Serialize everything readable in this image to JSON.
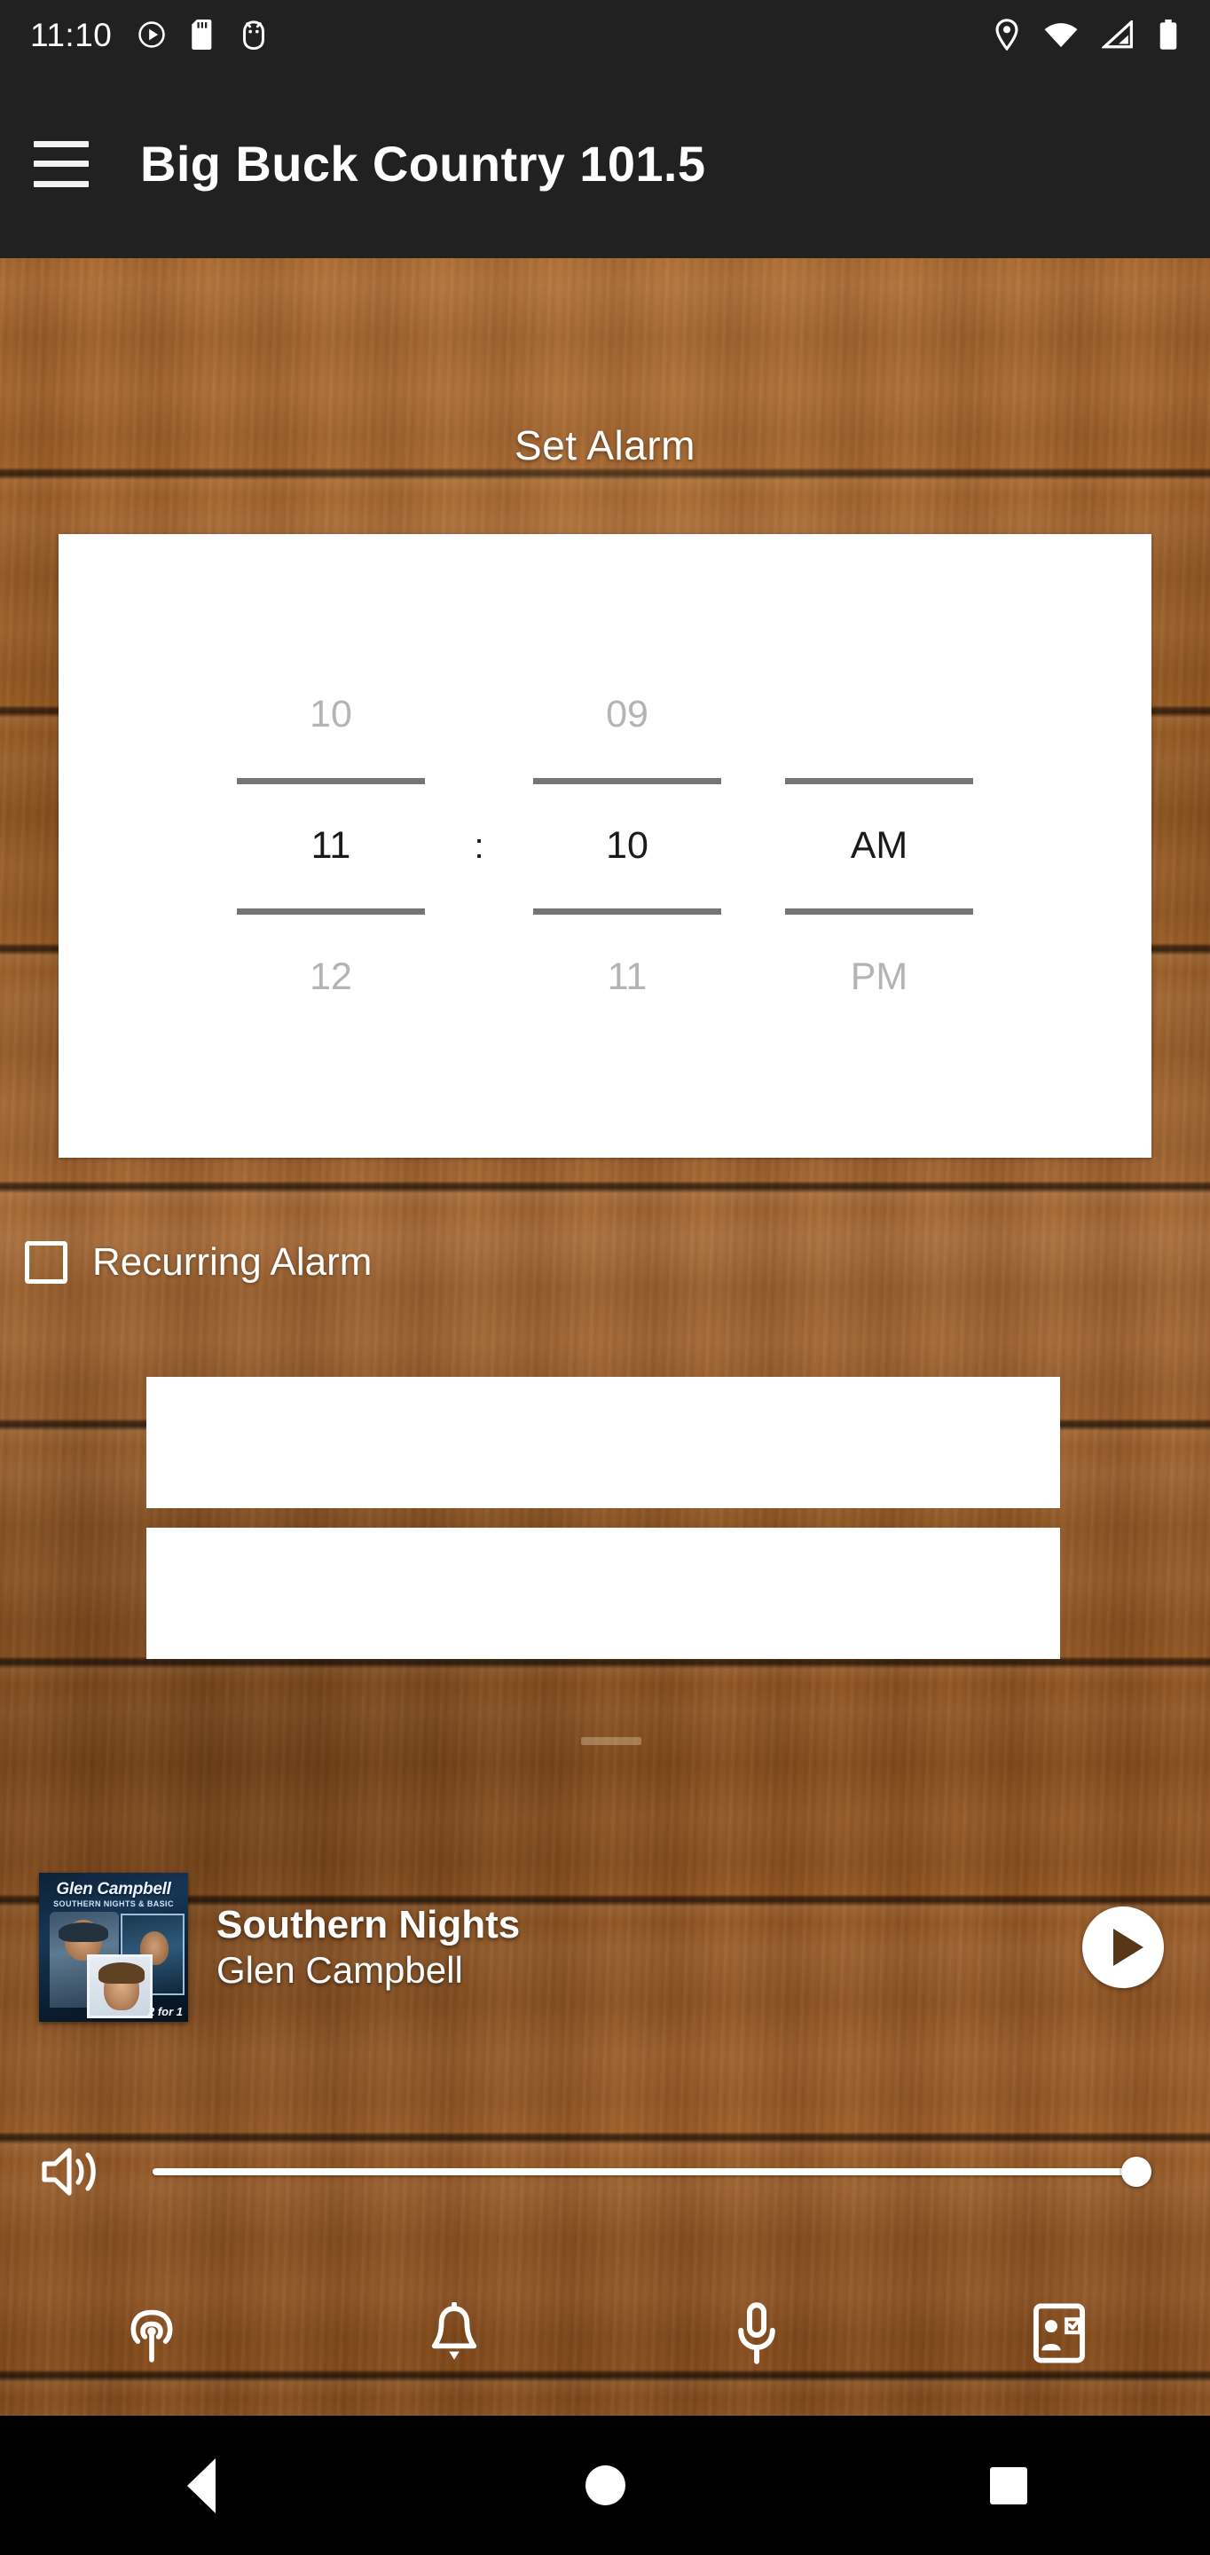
{
  "statusbar": {
    "clock": "11:10",
    "left_icons": [
      "play-circle-icon",
      "sd-card-icon",
      "android-debug-icon"
    ],
    "right_icons": [
      "location-pin-icon",
      "wifi-icon",
      "cell-signal-icon",
      "battery-icon"
    ],
    "background_color": "#212121"
  },
  "toolbar": {
    "menu_icon": "hamburger-menu-icon",
    "title": "Big Buck Country 101.5",
    "background_color": "#212121",
    "title_color": "#ffffff"
  },
  "screen": {
    "heading": "Set Alarm",
    "background": "wood-texture",
    "wood_color": "#9a5d2c"
  },
  "time_picker": {
    "hour": {
      "above": "10",
      "selected": "11",
      "below": "12"
    },
    "separator": ":",
    "minute": {
      "above": "09",
      "selected": "10",
      "below": "11"
    },
    "meridiem": {
      "above": "",
      "selected": "AM",
      "below": "PM"
    },
    "card_color": "#ffffff",
    "selected_text_color": "#1a1a1a",
    "dim_text_color": "#b4b4b4",
    "divider_color": "#757575"
  },
  "recurring": {
    "label": "Recurring Alarm",
    "checked": false,
    "checkbox_icon": "checkbox-unchecked-icon"
  },
  "panels": [
    {
      "name": "blank-panel-top",
      "text": ""
    },
    {
      "name": "blank-panel-bottom",
      "text": ""
    }
  ],
  "now_playing": {
    "album_art": {
      "artist_line": "Glen Campbell",
      "album_line": "SOUTHERN NIGHTS & BASIC",
      "badge": "2 for 1"
    },
    "song": "Southern Nights",
    "artist": "Glen Campbell",
    "play_button_icon": "play-icon",
    "play_button_label": "Play"
  },
  "volume": {
    "icon": "speaker-volume-icon",
    "value": 100,
    "min": 0,
    "max": 100,
    "track_color": "#ffffff"
  },
  "bottom_nav": [
    {
      "name": "nav-broadcast",
      "icon": "broadcast-antenna-icon",
      "label": "Listen"
    },
    {
      "name": "nav-alarm",
      "icon": "bell-icon",
      "label": "Alarm"
    },
    {
      "name": "nav-microphone",
      "icon": "microphone-icon",
      "label": "Request"
    },
    {
      "name": "nav-contact",
      "icon": "contact-card-icon",
      "label": "Contact"
    }
  ],
  "system_nav": {
    "back": "back-triangle-icon",
    "home": "home-circle-icon",
    "recents": "recents-square-icon"
  }
}
